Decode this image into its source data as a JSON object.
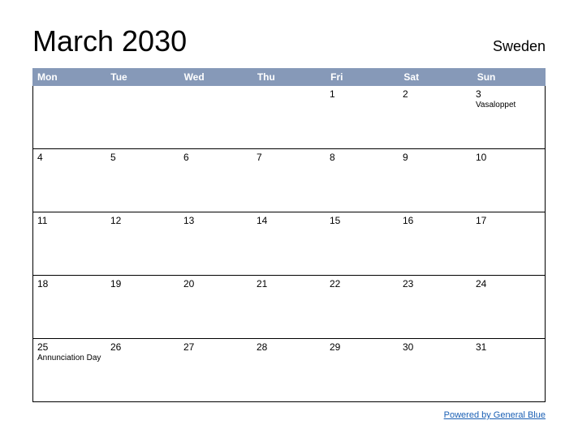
{
  "title": "March 2030",
  "country": "Sweden",
  "dayHeaders": [
    "Mon",
    "Tue",
    "Wed",
    "Thu",
    "Fri",
    "Sat",
    "Sun"
  ],
  "weeks": [
    [
      {
        "day": "",
        "event": ""
      },
      {
        "day": "",
        "event": ""
      },
      {
        "day": "",
        "event": ""
      },
      {
        "day": "",
        "event": ""
      },
      {
        "day": "1",
        "event": ""
      },
      {
        "day": "2",
        "event": ""
      },
      {
        "day": "3",
        "event": "Vasaloppet"
      }
    ],
    [
      {
        "day": "4",
        "event": ""
      },
      {
        "day": "5",
        "event": ""
      },
      {
        "day": "6",
        "event": ""
      },
      {
        "day": "7",
        "event": ""
      },
      {
        "day": "8",
        "event": ""
      },
      {
        "day": "9",
        "event": ""
      },
      {
        "day": "10",
        "event": ""
      }
    ],
    [
      {
        "day": "11",
        "event": ""
      },
      {
        "day": "12",
        "event": ""
      },
      {
        "day": "13",
        "event": ""
      },
      {
        "day": "14",
        "event": ""
      },
      {
        "day": "15",
        "event": ""
      },
      {
        "day": "16",
        "event": ""
      },
      {
        "day": "17",
        "event": ""
      }
    ],
    [
      {
        "day": "18",
        "event": ""
      },
      {
        "day": "19",
        "event": ""
      },
      {
        "day": "20",
        "event": ""
      },
      {
        "day": "21",
        "event": ""
      },
      {
        "day": "22",
        "event": ""
      },
      {
        "day": "23",
        "event": ""
      },
      {
        "day": "24",
        "event": ""
      }
    ],
    [
      {
        "day": "25",
        "event": "Annunciation Day"
      },
      {
        "day": "26",
        "event": ""
      },
      {
        "day": "27",
        "event": ""
      },
      {
        "day": "28",
        "event": ""
      },
      {
        "day": "29",
        "event": ""
      },
      {
        "day": "30",
        "event": ""
      },
      {
        "day": "31",
        "event": ""
      }
    ]
  ],
  "footerLink": "Powered by General Blue"
}
